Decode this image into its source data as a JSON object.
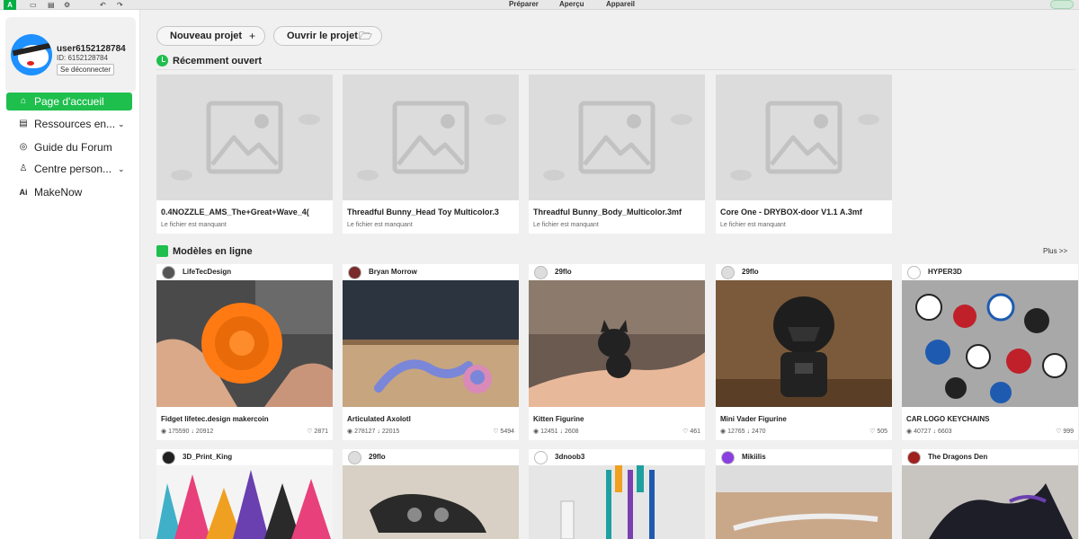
{
  "topbar": {
    "logo": "A",
    "icons": [
      "folder-icon",
      "save-icon",
      "gear-icon",
      "undo-icon",
      "redo-icon"
    ],
    "tabs": [
      "Préparer",
      "Aperçu",
      "Appareil"
    ]
  },
  "user": {
    "name": "user6152128784",
    "id": "ID: 6152128784",
    "logout": "Se déconnecter"
  },
  "nav": [
    {
      "label": "Page d'accueil",
      "icon": "home-icon",
      "active": true
    },
    {
      "label": "Ressources en...",
      "icon": "resources-icon",
      "dropdown": true
    },
    {
      "label": "Guide du Forum",
      "icon": "compass-icon"
    },
    {
      "label": "Centre person...",
      "icon": "person-icon",
      "dropdown": true
    },
    {
      "label": "MakeNow",
      "icon": "ai-icon"
    }
  ],
  "actions": {
    "new_project": "Nouveau projet",
    "open_project": "Ouvrir le projet"
  },
  "recent": {
    "title": "Récemment ouvert",
    "items": [
      {
        "name": "0.4NOZZLE_AMS_The+Great+Wave_4(",
        "status": "Le fichier est manquant"
      },
      {
        "name": "Threadful Bunny_Head Toy Multicolor.3",
        "status": "Le fichier est manquant"
      },
      {
        "name": "Threadful Bunny_Body_Multicolor.3mf",
        "status": "Le fichier est manquant"
      },
      {
        "name": "Core One - DRYBOX-door V1.1 A.3mf",
        "status": "Le fichier est manquant"
      }
    ]
  },
  "online": {
    "title": "Modèles en ligne",
    "more": "Plus >>",
    "models": [
      {
        "author": "LifeTecDesign",
        "title": "Fidget lifetec.design makercoin",
        "views": "175590",
        "downloads": "20912",
        "likes": "2871"
      },
      {
        "author": "Bryan Morrow",
        "title": "Articulated Axolotl",
        "views": "278127",
        "downloads": "22015",
        "likes": "5494"
      },
      {
        "author": "29flo",
        "title": "Kitten Figurine",
        "views": "12451",
        "downloads": "2608",
        "likes": "461"
      },
      {
        "author": "29flo",
        "title": "Mini Vader Figurine",
        "views": "12765",
        "downloads": "2470",
        "likes": "505"
      },
      {
        "author": "HYPER3D",
        "title": "CAR LOGO KEYCHAINS",
        "views": "40727",
        "downloads": "6603",
        "likes": "999"
      },
      {
        "author": "3D_Print_King"
      },
      {
        "author": "29flo"
      },
      {
        "author": "3dnoob3"
      },
      {
        "author": "Mikiilis"
      },
      {
        "author": "The Dragons Den"
      }
    ]
  },
  "colors": {
    "accent": "#1fbf4e",
    "placeholder": "#dcdcdc"
  }
}
